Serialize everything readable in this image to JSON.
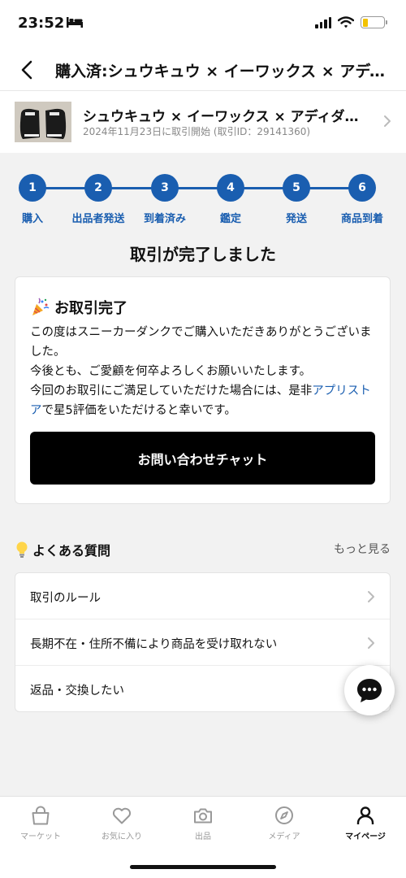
{
  "status_bar": {
    "time": "23:52"
  },
  "header": {
    "title": "購入済:シュウキュウ × イーワックス × アディダス"
  },
  "product": {
    "name": "シュウキュウ × イーワックス × アディダス オリジナルス",
    "meta": "2024年11月23日に取引開始 (取引ID：29141360)"
  },
  "progress": {
    "steps": [
      {
        "num": "1",
        "label": "購入"
      },
      {
        "num": "2",
        "label": "出品者発送"
      },
      {
        "num": "3",
        "label": "到着済み"
      },
      {
        "num": "4",
        "label": "鑑定"
      },
      {
        "num": "5",
        "label": "発送"
      },
      {
        "num": "6",
        "label": "商品到着"
      }
    ],
    "completed_steps": 6
  },
  "main": {
    "complete_title": "取引が完了しました",
    "card": {
      "heading": "お取引完了",
      "body_1": "この度はスニーカーダンクでご購入いただきありがとうございました。",
      "body_2": "今後とも、ご愛顧を何卒よろしくお願いいたします。",
      "body_3a": "今回のお取引にご満足していただけた場合には、是非",
      "body_link": "アプリストア",
      "body_3b": "で星5評価をいただけると幸いです。",
      "chat_button": "お問い合わせチャット"
    }
  },
  "faq": {
    "title": "よくある質問",
    "more": "もっと見る",
    "items": [
      {
        "label": "取引のルール"
      },
      {
        "label": "長期不在・住所不備により商品を受け取れない"
      },
      {
        "label": "返品・交換したい"
      }
    ]
  },
  "tabbar": {
    "tabs": [
      {
        "label": "マーケット",
        "icon": "bag-icon"
      },
      {
        "label": "お気に入り",
        "icon": "heart-icon"
      },
      {
        "label": "出品",
        "icon": "camera-icon"
      },
      {
        "label": "メディア",
        "icon": "compass-icon"
      },
      {
        "label": "マイページ",
        "icon": "person-icon"
      }
    ],
    "active": "マイページ"
  },
  "colors": {
    "accent": "#1a5eb0",
    "button": "#000000",
    "battery": "#f2c200"
  }
}
